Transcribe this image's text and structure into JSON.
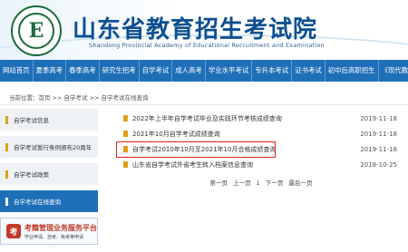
{
  "header": {
    "logo_letter": "E",
    "title": "山东省教育招生考试院",
    "subtitle": "Shandong Provincial Academy of Educational Recruitment and Examination"
  },
  "nav": [
    "网站首页",
    "夏季高考",
    "春季高考",
    "研究生招考",
    "自学考试",
    "成人高考",
    "学业水平考试",
    "专升本考试",
    "证书考试",
    "初中后高职招生",
    "《现代教育》"
  ],
  "breadcrumb": "当前位置：首页 >> 自学考试 >> 自学考试在线查询",
  "sidebar": {
    "items": [
      "自学考试信息",
      "自学考试暂行条例颁布20周年",
      "自学考试政策",
      "自学考试在线查询"
    ],
    "service_icon": "考",
    "service_title": "考籍管理业务服务平台",
    "service_sub": "毕业申请、自考、免考等申请"
  },
  "list": [
    {
      "title": "2022年上半年自学考试毕业及实践环节考核成绩查询",
      "date": "2019-11-18"
    },
    {
      "title": "2021年10月自学考试成绩查询",
      "date": "2019-11-18"
    },
    {
      "title": "自学考试2010年10月至2021年10月合格成绩查询",
      "date": "2019-11-18"
    },
    {
      "title": "山东省自学考试外省考生转入档案信息查询",
      "date": "2018-10-25"
    }
  ],
  "pager": [
    "第一页",
    "上一页",
    "1",
    "下一页",
    "最后一页"
  ],
  "colors": {
    "nav_bg": "#1f6fb8",
    "title": "#0b4f91",
    "accent": "#e0a015",
    "highlight_border": "#e02020"
  }
}
